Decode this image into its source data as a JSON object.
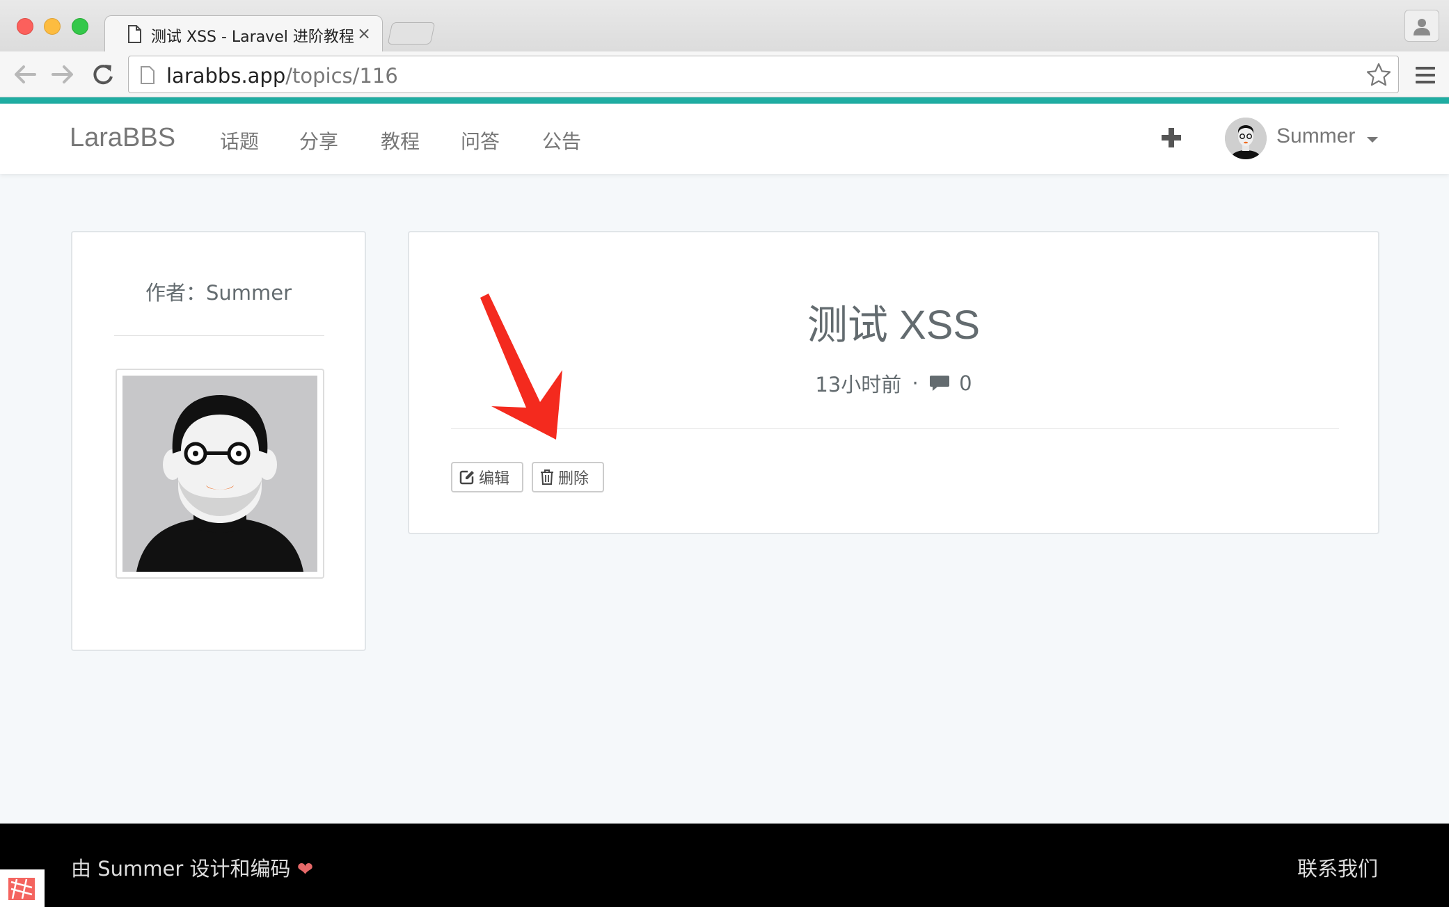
{
  "browser": {
    "tab_title": "测试 XSS - Laravel 进阶教程",
    "tab_close": "×",
    "url_host": "larabbs.app",
    "url_path": "/topics/116"
  },
  "navbar": {
    "brand": "LaraBBS",
    "links": [
      "话题",
      "分享",
      "教程",
      "问答",
      "公告"
    ],
    "user_name": "Summer"
  },
  "author": {
    "label": "作者：Summer"
  },
  "topic": {
    "title": "测试 XSS",
    "time_ago": "13小时前",
    "separator": "·",
    "reply_count": "0",
    "edit_label": "编辑",
    "delete_label": "删除"
  },
  "footer": {
    "credit": "由 Summer 设计和编码",
    "heart": "❤",
    "contact": "联系我们"
  },
  "colors": {
    "accent": "#1fada2",
    "annotation_arrow": "#f42a1e",
    "heart": "#e76969"
  },
  "icons": [
    "back-arrow-icon",
    "forward-arrow-icon",
    "reload-icon",
    "page-icon",
    "star-icon",
    "hamburger-menu-icon",
    "profile-icon",
    "plus-icon",
    "comment-icon",
    "edit-icon",
    "trash-icon",
    "heart-icon",
    "laravel-logo-icon"
  ]
}
